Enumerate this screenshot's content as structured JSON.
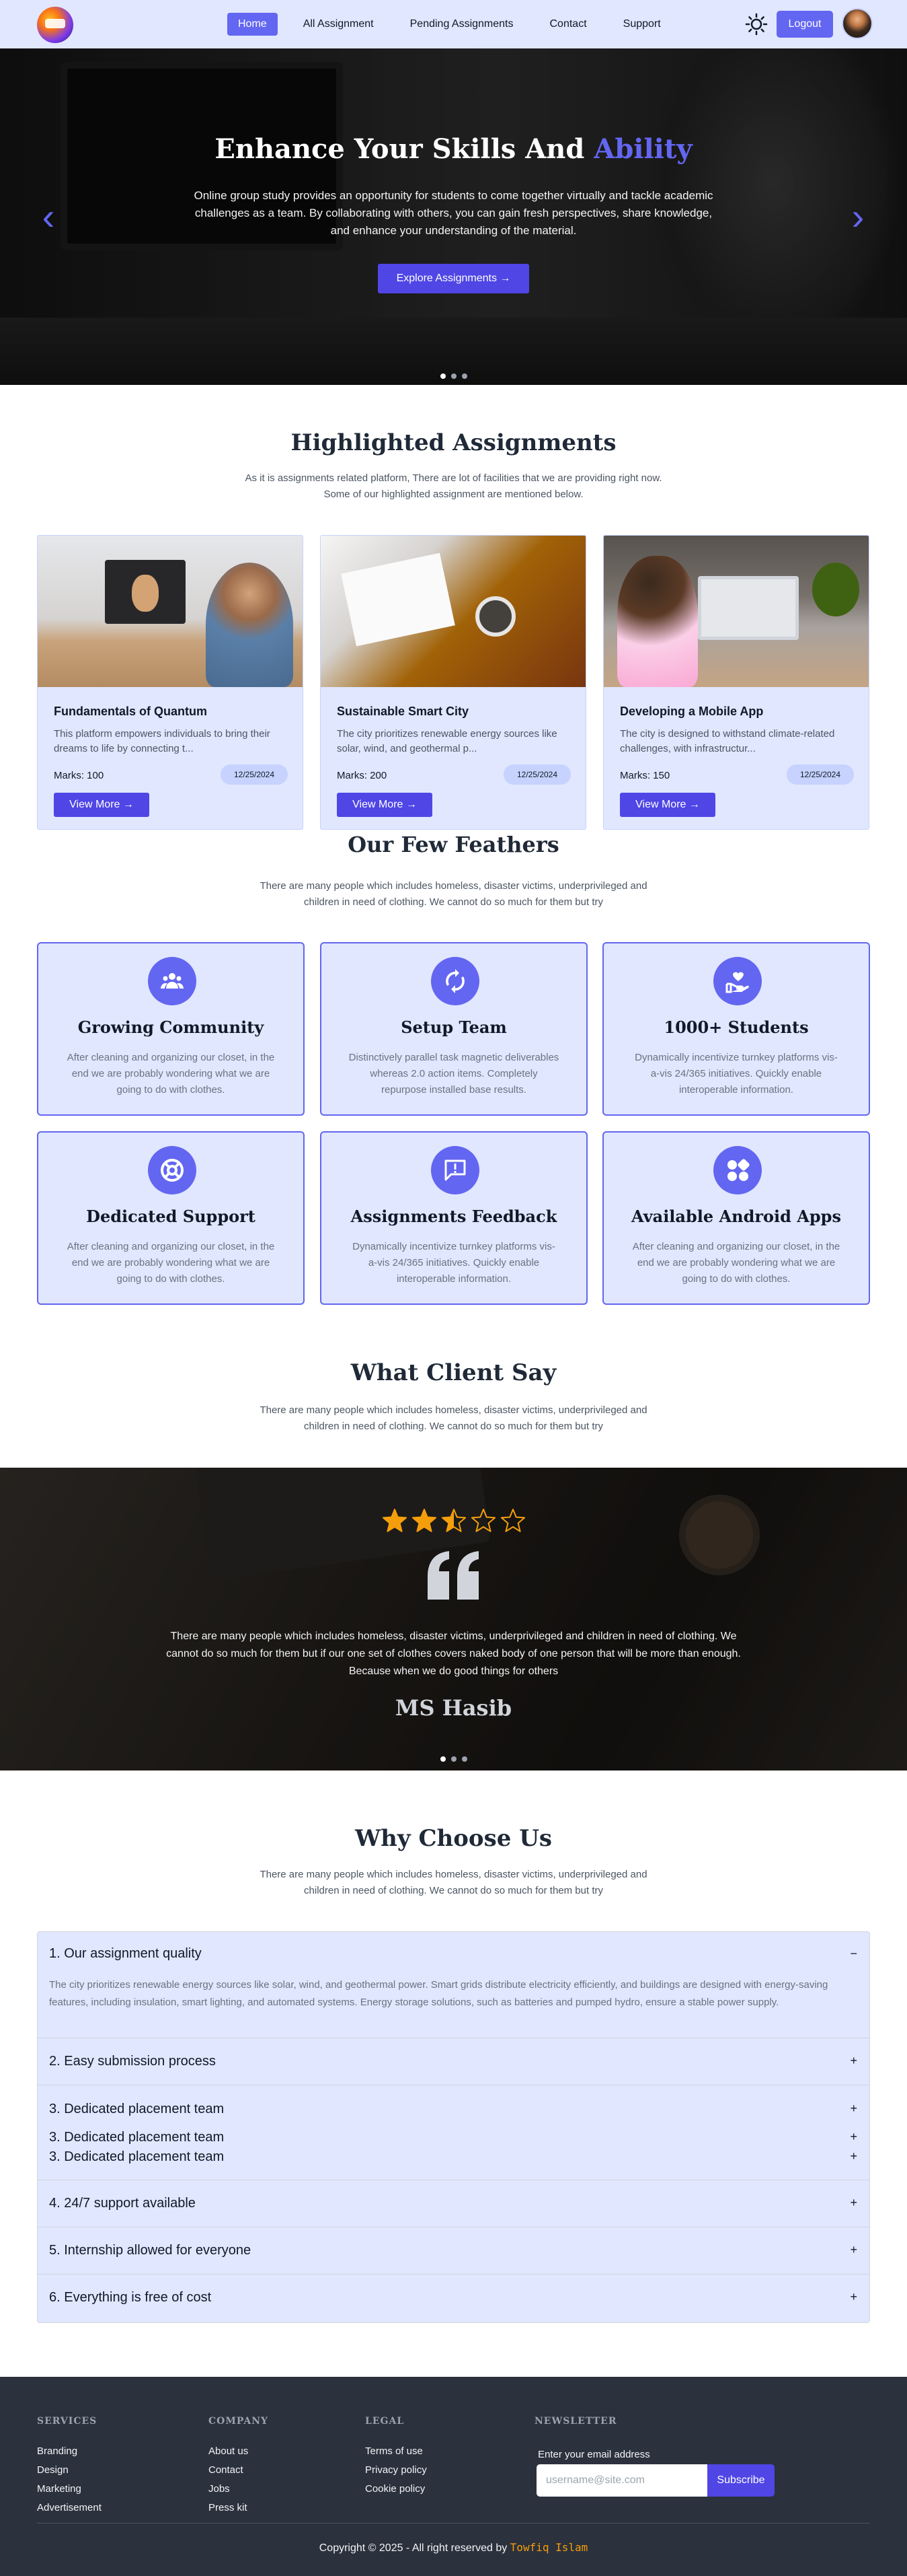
{
  "nav": {
    "links": [
      "Home",
      "All Assignment",
      "Pending Assignments",
      "Contact",
      "Support"
    ],
    "logout_label": "Logout"
  },
  "hero": {
    "title_main": "Enhance Your Skills And",
    "title_accent": "Ability",
    "text": "Online group study provides an opportunity for students to come together virtually and tackle academic challenges as a team. By collaborating with others, you can gain fresh perspectives, share knowledge, and enhance your understanding of the material.",
    "button_label": "Explore Assignments →",
    "slides_total": 3,
    "active_slide": 1
  },
  "highlighted": {
    "title": "Highlighted Assignments",
    "subtitle": "As it is assignments related platform, There are lot of facilities that we are providing right now. Some of our highlighted assignment are mentioned below.",
    "cards": [
      {
        "title": "Fundamentals of Quantum",
        "desc": "This platform empowers individuals to bring their dreams to life by connecting t...",
        "marks": "Marks: 100",
        "date": "12/25/2024",
        "button": "View More →"
      },
      {
        "title": "Sustainable Smart City",
        "desc": "The city prioritizes renewable energy sources like solar, wind, and geothermal p...",
        "marks": "Marks: 200",
        "date": "12/25/2024",
        "button": "View More →"
      },
      {
        "title": "Developing a Mobile App",
        "desc": "The city is designed to withstand climate-related challenges, with infrastructur...",
        "marks": "Marks: 150",
        "date": "12/25/2024",
        "button": "View More →"
      }
    ]
  },
  "features": {
    "title": "Our Few Feathers",
    "subtitle": "There are many people which includes homeless, disaster victims, underprivileged and children in need of clothing. We cannot do so much for them but try",
    "items": [
      {
        "icon": "community-icon",
        "title": "Growing Community",
        "desc": "After cleaning and organizing our closet, in the end we are probably wondering what we are going to do with clothes."
      },
      {
        "icon": "sync-icon",
        "title": "Setup Team",
        "desc": "Distinctively parallel task magnetic deliverables whereas 2.0 action items. Completely repurpose installed base results."
      },
      {
        "icon": "heart-hand-icon",
        "title": "1000+ Students",
        "desc": "Dynamically incentivize turnkey platforms vis-a-vis 24/365 initiatives. Quickly enable interoperable information."
      },
      {
        "icon": "lifebuoy-icon",
        "title": "Dedicated Support",
        "desc": "After cleaning and organizing our closet, in the end we are probably wondering what we are going to do with clothes."
      },
      {
        "icon": "feedback-icon",
        "title": "Assignments Feedback",
        "desc": "Dynamically incentivize turnkey platforms vis-a-vis 24/365 initiatives. Quickly enable interoperable information."
      },
      {
        "icon": "apps-icon",
        "title": "Available Android Apps",
        "desc": "After cleaning and organizing our closet, in the end we are probably wondering what we are going to do with clothes."
      }
    ]
  },
  "clients": {
    "title": "What Client Say",
    "subtitle": "There are many people which includes homeless, disaster victims, underprivileged and children in need of clothing. We cannot do so much for them but try",
    "rating": 2.5,
    "rating_max": 5,
    "text": "There are many people which includes homeless, disaster victims, underprivileged and children in need of clothing. We cannot do so much for them but if our one set of clothes covers naked body of one person that will be more than enough. Because when we do good things for others",
    "name": "MS Hasib",
    "slides_total": 3,
    "active_slide": 1
  },
  "why": {
    "title": "Why Choose Us",
    "subtitle": "There are many people which includes homeless, disaster victims, underprivileged and children in need of clothing. We cannot do so much for them but try",
    "faq": [
      {
        "q": "1. Our assignment quality",
        "sign": "−",
        "answer": "The city prioritizes renewable energy sources like solar, wind, and geothermal power. Smart grids distribute electricity efficiently, and buildings are designed with energy-saving features, including insulation, smart lighting, and automated systems. Energy storage solutions, such as batteries and pumped hydro, ensure a stable power supply."
      },
      {
        "q": "2. Easy submission process",
        "sign": "+"
      },
      {
        "q": "3. Dedicated placement team",
        "sign": "+"
      },
      {
        "q": "3. Dedicated placement team",
        "sign": "+"
      },
      {
        "q": "3. Dedicated placement team",
        "sign": "+"
      },
      {
        "q": "4. 24/7 support available",
        "sign": "+"
      },
      {
        "q": "5. Internship allowed for everyone",
        "sign": "+"
      },
      {
        "q": "6. Everything is free of cost",
        "sign": "+"
      }
    ]
  },
  "footer": {
    "services_title": "SERVICES",
    "services": [
      "Branding",
      "Design",
      "Marketing",
      "Advertisement"
    ],
    "company_title": "COMPANY",
    "company": [
      "About us",
      "Contact",
      "Jobs",
      "Press kit"
    ],
    "legal_title": "LEGAL",
    "legal": [
      "Terms of use",
      "Privacy policy",
      "Cookie policy"
    ],
    "newsletter_title": "NEWSLETTER",
    "newsletter_label": "Enter your email address",
    "newsletter_placeholder": "username@site.com",
    "subscribe_label": "Subscribe",
    "copyright_text": "Copyright © 2025 - All right reserved by",
    "copyright_author": "Towfiq Islam"
  },
  "colors": {
    "accent": "#6366f1",
    "button": "#4f46e5",
    "card_bg": "#e0e7ff",
    "footer_bg": "#2b313d",
    "star": "#f59e0b"
  }
}
